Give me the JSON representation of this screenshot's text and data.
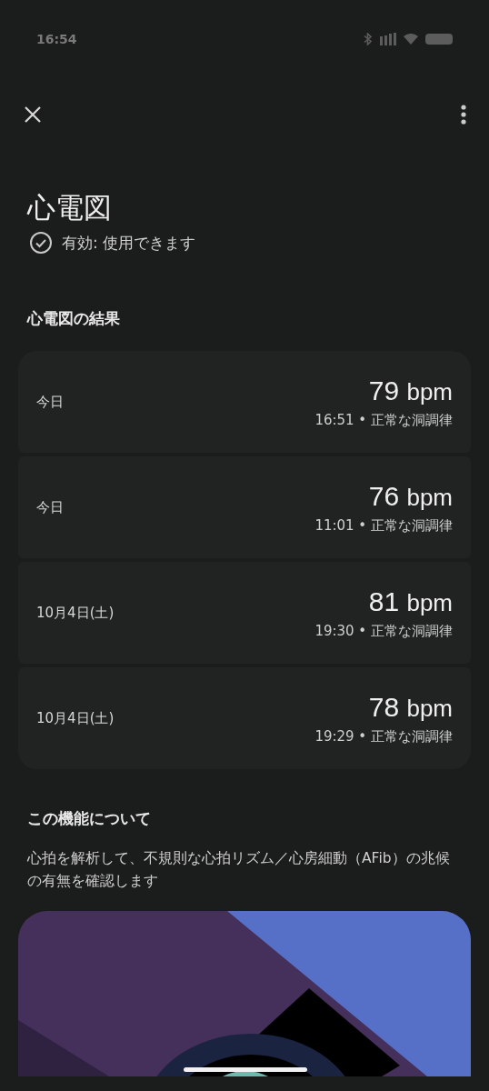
{
  "status_bar": {
    "time": "16:54"
  },
  "header": {
    "title": "心電図",
    "status": "有効: 使用できます"
  },
  "results": {
    "heading": "心電図の結果",
    "items": [
      {
        "date": "今日",
        "bpm": "79",
        "unit": "bpm",
        "detail": "16:51 • 正常な洞調律"
      },
      {
        "date": "今日",
        "bpm": "76",
        "unit": "bpm",
        "detail": "11:01 • 正常な洞調律"
      },
      {
        "date": "10月4日(土)",
        "bpm": "81",
        "unit": "bpm",
        "detail": "19:30 • 正常な洞調律"
      },
      {
        "date": "10月4日(土)",
        "bpm": "78",
        "unit": "bpm",
        "detail": "19:29 • 正常な洞調律"
      }
    ]
  },
  "about": {
    "heading": "この機能について",
    "description": "心拍を解析して、不規則な心拍リズム／心房細動（AFib）の兆候の有無を確認します"
  }
}
